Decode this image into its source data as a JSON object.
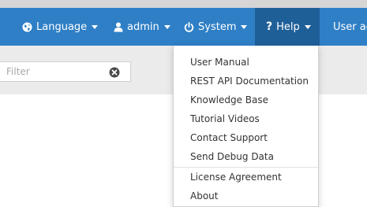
{
  "navbar": {
    "background": "#2f7fc6",
    "active_background": "#1f5f98",
    "items": [
      {
        "label": "Language",
        "icon": "globe-icon"
      },
      {
        "label": "admin",
        "icon": "user-icon"
      },
      {
        "label": "System",
        "icon": "power-icon"
      },
      {
        "label": "Help",
        "icon": "question-icon"
      },
      {
        "label": "User act"
      }
    ]
  },
  "filter": {
    "placeholder": "Filter",
    "value": "",
    "clear_icon": "clear-icon"
  },
  "help_menu": {
    "items": [
      "User Manual",
      "REST API Documentation",
      "Knowledge Base",
      "Tutorial Videos",
      "Contact Support",
      "Send Debug Data",
      "License Agreement",
      "About"
    ]
  }
}
